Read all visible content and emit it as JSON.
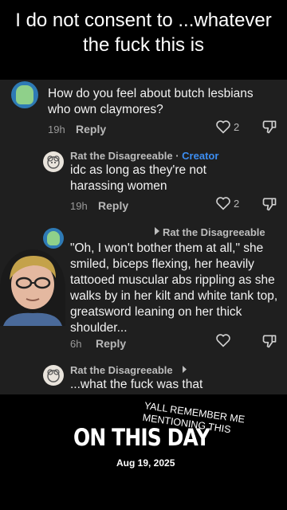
{
  "caption": "I do not consent to ...whatever the fuck this is",
  "comments": [
    {
      "text": "How do you feel about butch lesbians who own claymores?",
      "age": "19h",
      "reply_label": "Reply",
      "likes": "2"
    },
    {
      "username": "Rat the Disagreeable",
      "separator": " · ",
      "badge": "Creator",
      "text": "idc as long as they're not harassing women",
      "age": "19h",
      "reply_label": "Reply",
      "likes": "2"
    },
    {
      "reply_to": "Rat the Disagreeable",
      "text": "\"Oh, I won't bother them at all,\" she smiled, biceps flexing, her heavily tattooed muscular abs rippling as she walks by in her kilt and white tank top, greatsword leaning on her thick shoulder...",
      "age": "6h",
      "reply_label": "Reply"
    },
    {
      "username": "Rat the Disagreeable",
      "text": "...what the fuck was that"
    }
  ],
  "overlay": {
    "note": "YALL REMEMBER ME MENTIONING THIS",
    "title": "ON THIS DAY",
    "date": "Aug 19, 2025"
  },
  "colors": {
    "background": "#000000",
    "panel": "#1f1f1f",
    "creator_badge": "#3d8ef2"
  },
  "icons": [
    "heart-icon",
    "dislike-icon",
    "reply-arrow-icon",
    "chevron-right-icon"
  ]
}
